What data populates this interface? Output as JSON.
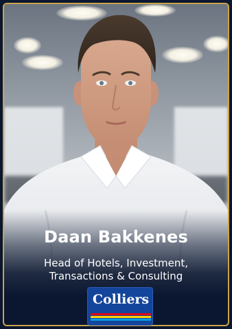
{
  "profile": {
    "name": "Daan Bakkenes",
    "role_line_1": "Head of Hotels, Investment,",
    "role_line_2": "Transactions & Consulting"
  },
  "brand": {
    "logo_text": "Colliers",
    "logo_bg": "#14459c",
    "stripe_colors": [
      "#e30613",
      "#ffd200",
      "#00a0e3",
      "#1fa74a"
    ],
    "card_bg": "#0b1730",
    "border_accent": "#c9a44a"
  }
}
